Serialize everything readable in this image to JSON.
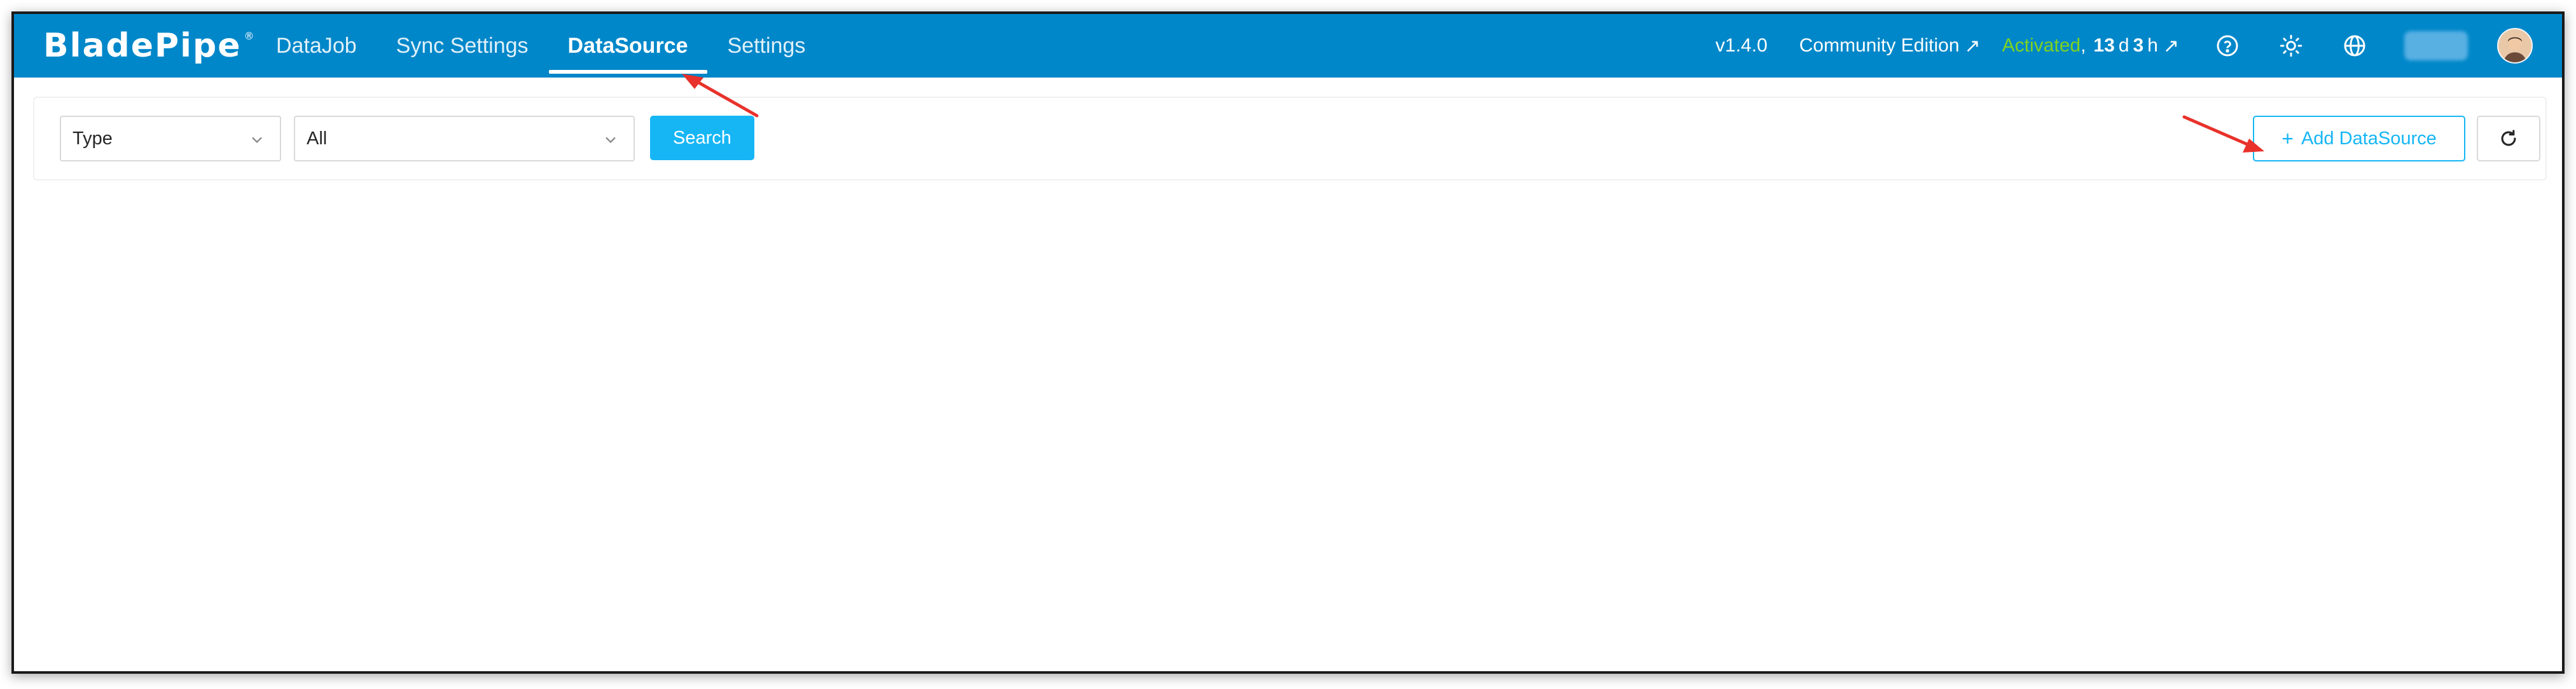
{
  "app": {
    "logo": "BladePipe",
    "logo_mark": "®"
  },
  "nav": {
    "tabs": [
      {
        "label": "DataJob"
      },
      {
        "label": "Sync Settings"
      },
      {
        "label": "DataSource"
      },
      {
        "label": "Settings"
      }
    ],
    "active_tab": "DataSource",
    "version": "v1.4.0",
    "edition": "Community Edition",
    "license": {
      "status": "Activated",
      "separator": ",",
      "days_value": "13",
      "days_unit": "d",
      "hours_value": "3",
      "hours_unit": "h"
    },
    "icons": [
      "help-icon",
      "theme-sun-icon",
      "language-globe-icon",
      "external-link-arrow-icon",
      "avatar"
    ]
  },
  "filters": {
    "type_select": {
      "value": "Type"
    },
    "scope_select": {
      "value": "All"
    },
    "search_label": "Search"
  },
  "actions": {
    "add_label": "Add DataSource",
    "add_prefix": "+"
  },
  "colors": {
    "nav_bg": "#0087c9",
    "accent": "#16b6f5",
    "activated": "#7ed321",
    "annotation_arrow": "#e8322b"
  }
}
